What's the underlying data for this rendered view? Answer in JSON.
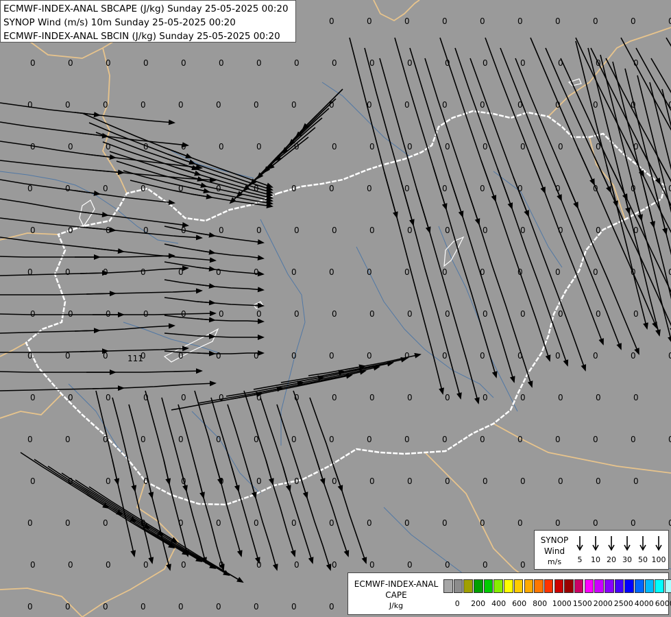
{
  "header": {
    "line1": "ECMWF-INDEX-ANAL SBCAPE (J/kg) Sunday 25-05-2025 00:20",
    "line2": "SYNOP Wind (m/s) 10m Sunday 25-05-2025 00:20",
    "line3": "ECMWF-INDEX-ANAL SBCIN (J/kg) Sunday 25-05-2025 00:20"
  },
  "field": {
    "cape_value_label": "0",
    "station_value_label": "111"
  },
  "colors": {
    "background": "#9a9a9a",
    "streamline": "#000000",
    "country_border": "#ffffff",
    "neighbor_border": "#e8c48c",
    "river": "#3f6fa8"
  },
  "synop_legend": {
    "title": "SYNOP",
    "subtitle": "Wind",
    "unit": "m/s",
    "speeds": [
      "5",
      "10",
      "20",
      "30",
      "50",
      "100"
    ]
  },
  "cape_legend": {
    "title": "ECMWF-INDEX-ANAL",
    "subtitle": "CAPE",
    "unit": "J/kg",
    "colors": [
      "#a6a6a6",
      "#8c8c8c",
      "#a0a000",
      "#00a000",
      "#00cc00",
      "#88ee00",
      "#ffff00",
      "#ffcc00",
      "#ffaa00",
      "#ff7700",
      "#ff3300",
      "#cc0000",
      "#990000",
      "#cc0066",
      "#ff00ff",
      "#cc00ff",
      "#8800ff",
      "#4400ff",
      "#0000ff",
      "#0066ff",
      "#00bbff",
      "#00ffff",
      "#aaffff",
      "#ffffff"
    ],
    "ticks": [
      "0",
      "200",
      "400",
      "600",
      "800",
      "1000",
      "1500",
      "2000",
      "2500",
      "4000",
      "6000"
    ]
  }
}
